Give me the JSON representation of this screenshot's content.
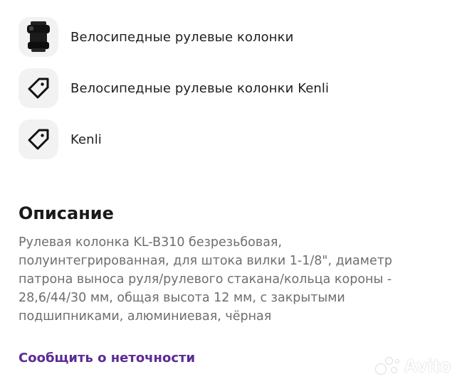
{
  "categories": [
    {
      "label": "Велосипедные рулевые колонки",
      "icon": "headset-image"
    },
    {
      "label": "Велосипедные рулевые колонки Kenli",
      "icon": "tag-icon"
    },
    {
      "label": "Kenli",
      "icon": "tag-icon"
    }
  ],
  "description": {
    "title": "Описание",
    "text": "Рулевая колонка KL-B310 безрезьбовая, полуинтегрированная, для штока вилки 1-1/8\", диаметр патрона выноса руля/рулевого стакана/кольца короны - 28,6/44/30 мм, общая высота 12 мм, с закрытыми подшипниками, алюминиевая, чёрная"
  },
  "report_link": "Сообщить о неточности",
  "watermark": {
    "text": "Avito"
  },
  "colors": {
    "link": "#5b2b94",
    "thumb_bg": "#f2f2f2",
    "text_muted": "#6e6e6e"
  }
}
